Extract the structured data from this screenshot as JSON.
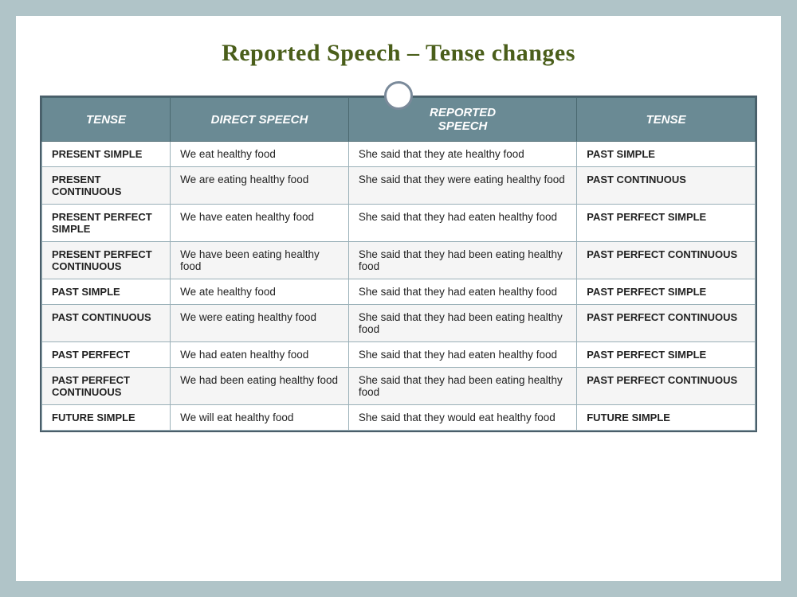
{
  "title": "Reported Speech – Tense changes",
  "columns": [
    "TENSE",
    "DIRECT SPEECH",
    "REPORTED SPEECH",
    "TENSE"
  ],
  "rows": [
    {
      "tense_in": "PRESENT SIMPLE",
      "direct": "We eat healthy food",
      "reported": "She said that they ate healthy food",
      "tense_out": "PAST SIMPLE"
    },
    {
      "tense_in": "PRESENT CONTINUOUS",
      "direct": "We are eating healthy food",
      "reported": "She said that they were eating healthy food",
      "tense_out": "PAST CONTINUOUS"
    },
    {
      "tense_in": "PRESENT PERFECT SIMPLE",
      "direct": "We have eaten healthy food",
      "reported": "She said that they had eaten healthy food",
      "tense_out": "PAST PERFECT SIMPLE"
    },
    {
      "tense_in": "PRESENT PERFECT CONTINUOUS",
      "direct": "We have been eating healthy food",
      "reported": "She said that they had been eating  healthy food",
      "tense_out": "PAST PERFECT CONTINUOUS"
    },
    {
      "tense_in": "PAST SIMPLE",
      "direct": "We ate healthy food",
      "reported": "She said that they had eaten healthy food",
      "tense_out": "PAST PERFECT SIMPLE"
    },
    {
      "tense_in": "PAST CONTINUOUS",
      "direct": "We were eating healthy food",
      "reported": "She said that they had been eating healthy food",
      "tense_out": "PAST PERFECT CONTINUOUS"
    },
    {
      "tense_in": "PAST PERFECT",
      "direct": "We had eaten healthy food",
      "reported": "She said that they had eaten healthy food",
      "tense_out": "PAST PERFECT SIMPLE"
    },
    {
      "tense_in": "PAST PERFECT CONTINUOUS",
      "direct": "We had been eating healthy food",
      "reported": "She said that they had been eating  healthy food",
      "tense_out": "PAST PERFECT CONTINUOUS"
    },
    {
      "tense_in": "FUTURE SIMPLE",
      "direct": "We will eat healthy food",
      "reported": "She said that they would eat healthy food",
      "tense_out": "FUTURE SIMPLE"
    }
  ]
}
